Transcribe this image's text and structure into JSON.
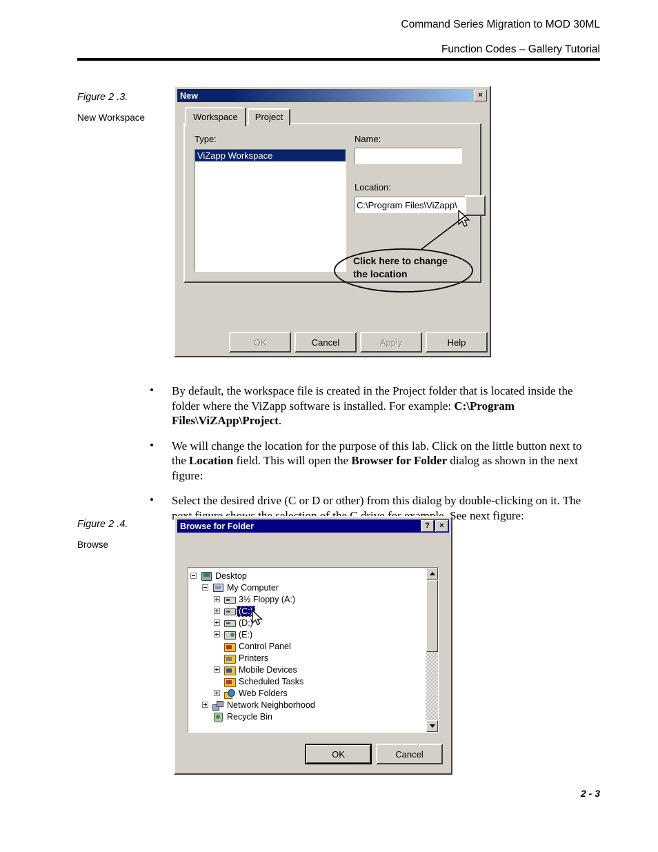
{
  "header": {
    "line1": "Command Series Migration to MOD 30ML",
    "line2": "Function Codes – Gallery Tutorial"
  },
  "figure1": {
    "number": "Figure 2 .3.",
    "label": "New Workspace"
  },
  "figure2": {
    "number": "Figure 2 .4.",
    "label": "Browse"
  },
  "new_dialog": {
    "title": "New",
    "close_label": "×",
    "tabs": [
      {
        "label": "Workspace",
        "active": true
      },
      {
        "label": "Project",
        "active": false
      }
    ],
    "type_label": "Type:",
    "type_items": [
      "ViZapp Workspace"
    ],
    "type_selected": "ViZapp Workspace",
    "name_label": "Name:",
    "name_value": "",
    "location_label": "Location:",
    "location_value": "C:\\Program Files\\ViZapp\\",
    "browse_button_label": "",
    "buttons": [
      {
        "label": "OK",
        "enabled": false
      },
      {
        "label": "Cancel",
        "enabled": true
      },
      {
        "label": "Apply",
        "enabled": false
      },
      {
        "label": "Help",
        "enabled": true
      }
    ],
    "callout_line1": "Click here to change",
    "callout_line2": "the location"
  },
  "bullets": [
    {
      "part1": "By default, the workspace file is created in the Project folder that is located inside the folder where the ViZapp software is installed. For example: ",
      "bold": "C:\\Program Files\\ViZApp\\Project",
      "part2": "."
    },
    {
      "part1": "We will change the location for the purpose of this lab. Click on the little button next to the ",
      "bold": "Location",
      "part2": " field. This will open the ",
      "bold2": "Browser for Folder",
      "part3": " dialog as shown in the next figure:"
    },
    {
      "part1": "Select the desired drive (C or D or other) from this dialog by double-clicking on it. The next figure shows the selection of the C drive for example. See next figure:"
    }
  ],
  "browse_dialog": {
    "title": "Browse for Folder",
    "help_label": "?",
    "close_label": "×",
    "tree": [
      {
        "label": "Desktop",
        "indent": 0,
        "expander": "minus",
        "icon": "desktop-icon",
        "selected": false
      },
      {
        "label": "My Computer",
        "indent": 1,
        "expander": "minus",
        "icon": "computer-icon",
        "selected": false
      },
      {
        "label": "3½ Floppy (A:)",
        "indent": 2,
        "expander": "plus",
        "icon": "floppy-icon",
        "selected": false
      },
      {
        "label": "(C:)",
        "indent": 2,
        "expander": "plus",
        "icon": "drive-icon",
        "selected": true
      },
      {
        "label": "(D:)",
        "indent": 2,
        "expander": "plus",
        "icon": "drive-icon",
        "selected": false
      },
      {
        "label": "(E:)",
        "indent": 2,
        "expander": "plus",
        "icon": "cd-drive-icon",
        "selected": false
      },
      {
        "label": "Control Panel",
        "indent": 2,
        "expander": "none",
        "icon": "control-panel-icon",
        "selected": false
      },
      {
        "label": "Printers",
        "indent": 2,
        "expander": "none",
        "icon": "printers-icon",
        "selected": false
      },
      {
        "label": "Mobile Devices",
        "indent": 2,
        "expander": "plus",
        "icon": "mobile-devices-icon",
        "selected": false
      },
      {
        "label": "Scheduled Tasks",
        "indent": 2,
        "expander": "none",
        "icon": "scheduled-tasks-icon",
        "selected": false
      },
      {
        "label": "Web Folders",
        "indent": 2,
        "expander": "plus",
        "icon": "web-folders-icon",
        "selected": false
      },
      {
        "label": "Network Neighborhood",
        "indent": 1,
        "expander": "plus",
        "icon": "network-icon",
        "selected": false
      },
      {
        "label": "Recycle Bin",
        "indent": 1,
        "expander": "none",
        "icon": "recycle-bin-icon",
        "selected": false
      }
    ],
    "buttons": [
      {
        "label": "OK",
        "default": true
      },
      {
        "label": "Cancel",
        "default": false
      }
    ]
  },
  "footer": {
    "page": "2 - 3"
  },
  "colors": {
    "title_active": "#0a246a",
    "title_solid": "#000080",
    "dialog_face": "#d4d0c8",
    "selection": "#000080",
    "text": "#000000"
  }
}
